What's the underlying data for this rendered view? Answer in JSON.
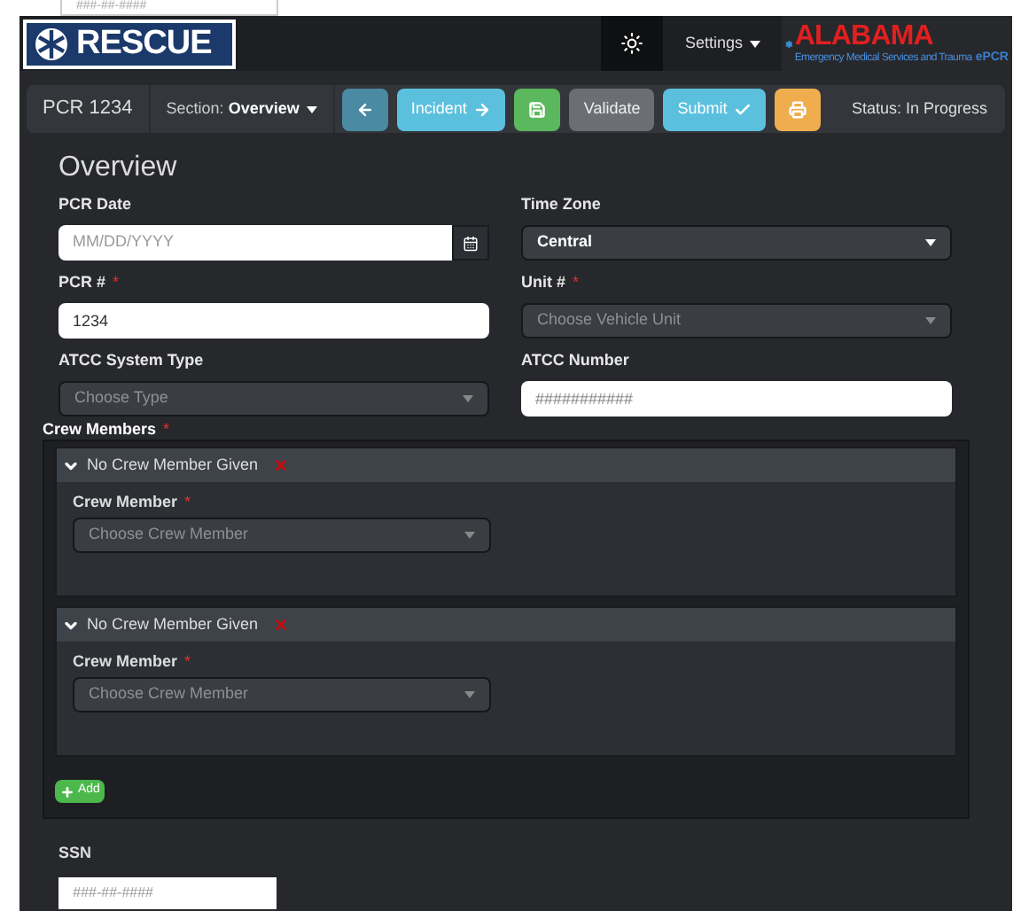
{
  "top_fragment": {
    "placeholder": "###-##-####"
  },
  "header": {
    "logo_text": "RESCUE",
    "settings_label": "Settings",
    "brand": {
      "name": "ALABAMA",
      "tagline": "Emergency Medical Services and Trauma",
      "product": "ePCR"
    }
  },
  "toolbar": {
    "pcr_title": "PCR 1234",
    "section_label": "Section:",
    "section_value": "Overview",
    "buttons": [
      {
        "kind": "icon"
      },
      {
        "kind": "text",
        "label": "Incident"
      },
      {
        "kind": "icon"
      },
      {
        "kind": "text",
        "label": "Validate"
      },
      {
        "kind": "text",
        "label": "Submit"
      },
      {
        "kind": "icon"
      }
    ],
    "status": "Status: In Progress"
  },
  "form": {
    "heading": "Overview",
    "fields": [
      {
        "kind": "date",
        "label": "PCR Date",
        "placeholder": "MM/DD/YYYY"
      },
      {
        "kind": "select",
        "label": "Time Zone",
        "value": "Central"
      },
      {
        "kind": "text",
        "label": "PCR #",
        "required_mark": "*",
        "value": "1234"
      },
      {
        "kind": "select",
        "label": "Unit #",
        "required_mark": "*",
        "placeholder": "Choose Vehicle Unit"
      },
      {
        "kind": "select",
        "label": "ATCC System Type",
        "placeholder": "Choose Type"
      },
      {
        "kind": "text",
        "label": "ATCC Number",
        "placeholder": "###########"
      }
    ]
  },
  "crew": {
    "label": "Crew Members",
    "required_mark": "*",
    "members": [
      {
        "title": "No Crew Member Given",
        "expanded": true,
        "field_label": "Crew Member",
        "required_mark": "*",
        "placeholder": "Choose Crew Member"
      },
      {
        "title": "No Crew Member Given",
        "expanded": true,
        "field_label": "Crew Member",
        "required_mark": "*",
        "placeholder": "Choose Crew Member"
      }
    ],
    "add_label": "Add"
  },
  "ssn": {
    "label": "SSN",
    "placeholder": "###-##-####"
  }
}
